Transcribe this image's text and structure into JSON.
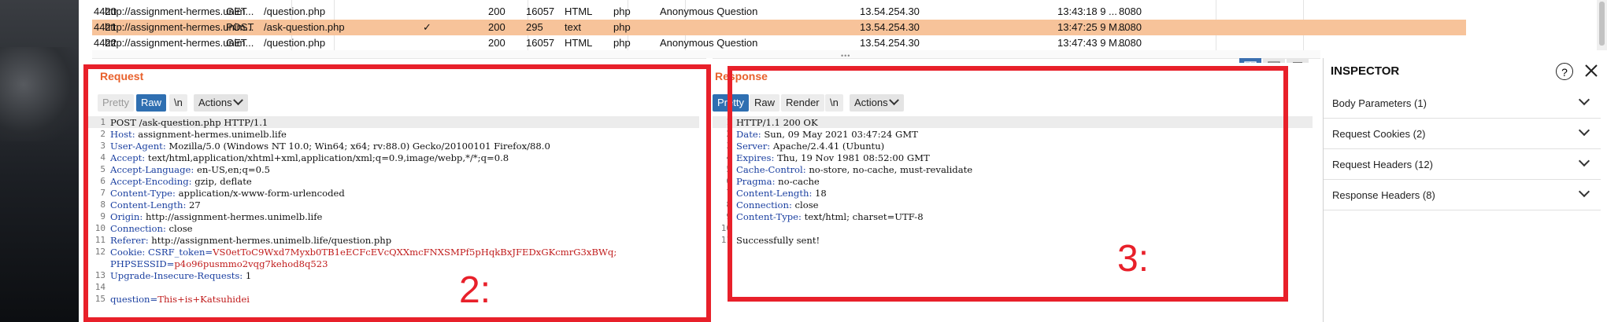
{
  "history": {
    "rows": [
      {
        "id": "4420",
        "host": "http://assignment-hermes.unim...",
        "method": "GET",
        "url": "/question.php",
        "check": "",
        "status": "200",
        "length": "16057",
        "mime": "HTML",
        "ext": "php",
        "title": "Anonymous Question",
        "ip": "13.54.254.30",
        "time": "13:43:18 9 ...",
        "port": "8080",
        "selected": false
      },
      {
        "id": "4421",
        "host": "http://assignment-hermes.unim...",
        "method": "POST",
        "url": "/ask-question.php",
        "check": "✓",
        "status": "200",
        "length": "295",
        "mime": "text",
        "ext": "php",
        "title": "",
        "ip": "13.54.254.30",
        "time": "13:47:25 9 M...",
        "port": "8080",
        "selected": true
      },
      {
        "id": "4422",
        "host": "http://assignment-hermes.unim...",
        "method": "GET",
        "url": "/question.php",
        "check": "",
        "status": "200",
        "length": "16057",
        "mime": "HTML",
        "ext": "php",
        "title": "Anonymous Question",
        "ip": "13.54.254.30",
        "time": "13:47:43 9 M...",
        "port": "8080",
        "selected": false
      }
    ]
  },
  "request": {
    "title": "Request",
    "tabs": {
      "pretty": "Pretty",
      "raw": "Raw",
      "newline": "\\n",
      "actions": "Actions"
    },
    "lines": [
      {
        "n": "1",
        "plain": "POST /ask-question.php HTTP/1.1"
      },
      {
        "n": "2",
        "key": "Host:",
        "val": " assignment-hermes.unimelb.life"
      },
      {
        "n": "3",
        "key": "User-Agent:",
        "val": " Mozilla/5.0 (Windows NT 10.0; Win64; x64; rv:88.0) Gecko/20100101 Firefox/88.0"
      },
      {
        "n": "4",
        "key": "Accept:",
        "val": " text/html,application/xhtml+xml,application/xml;q=0.9,image/webp,*/*;q=0.8"
      },
      {
        "n": "5",
        "key": "Accept-Language:",
        "val": " en-US,en;q=0.5"
      },
      {
        "n": "6",
        "key": "Accept-Encoding:",
        "val": " gzip, deflate"
      },
      {
        "n": "7",
        "key": "Content-Type:",
        "val": " application/x-www-form-urlencoded"
      },
      {
        "n": "8",
        "key": "Content-Length:",
        "val": " 27"
      },
      {
        "n": "9",
        "key": "Origin:",
        "val": " http://assignment-hermes.unimelb.life"
      },
      {
        "n": "10",
        "key": "Connection:",
        "val": " close"
      },
      {
        "n": "11",
        "key": "Referer:",
        "val": " http://assignment-hermes.unimelb.life/question.php"
      },
      {
        "n": "12",
        "key": "Cookie:",
        "cookie1": " CSRF_token=",
        "cookie1val": "VS0etToC9Wxd7Myxb0TB1eECFcEVcQXXmcFNXSMPf5pHqkBxJFEDxGKcmrG3xBWq;",
        "cookie2": "PHPSESSID=",
        "cookie2val": "p4o96pusmmo2vqg7kehod8q523"
      },
      {
        "n": "13",
        "key": "Upgrade-Insecure-Requests:",
        "val": " 1"
      },
      {
        "n": "14",
        "plain": ""
      },
      {
        "n": "15",
        "bodykey": "question=",
        "bodyval": "This+is+Katsuhidei"
      }
    ],
    "annotation": "2:"
  },
  "response": {
    "title": "Response",
    "tabs": {
      "pretty": "Pretty",
      "raw": "Raw",
      "render": "Render",
      "newline": "\\n",
      "actions": "Actions"
    },
    "lines": [
      {
        "n": "1",
        "plain": "HTTP/1.1 200 OK"
      },
      {
        "n": "2",
        "key": "Date:",
        "val": " Sun, 09 May 2021 03:47:24 GMT"
      },
      {
        "n": "3",
        "key": "Server:",
        "val": " Apache/2.4.41 (Ubuntu)"
      },
      {
        "n": "4",
        "key": "Expires:",
        "val": " Thu, 19 Nov 1981 08:52:00 GMT"
      },
      {
        "n": "5",
        "key": "Cache-Control:",
        "val": " no-store, no-cache, must-revalidate"
      },
      {
        "n": "6",
        "key": "Pragma:",
        "val": " no-cache"
      },
      {
        "n": "7",
        "key": "Content-Length:",
        "val": " 18"
      },
      {
        "n": "8",
        "key": "Connection:",
        "val": " close"
      },
      {
        "n": "9",
        "key": "Content-Type:",
        "val": " text/html; charset=UTF-8"
      },
      {
        "n": "10",
        "plain": ""
      },
      {
        "n": "11",
        "plain": "Successfully sent!"
      }
    ],
    "annotation": "3:"
  },
  "inspector": {
    "title": "INSPECTOR",
    "items": [
      {
        "label": "Body Parameters (1)"
      },
      {
        "label": "Request Cookies (2)"
      },
      {
        "label": "Request Headers (12)"
      },
      {
        "label": "Response Headers (8)"
      }
    ]
  },
  "colors": {
    "accent": "#e8612c",
    "selected_row": "#f7c39a",
    "annotation": "#e8202a",
    "active_tab": "#2f6fb1"
  }
}
